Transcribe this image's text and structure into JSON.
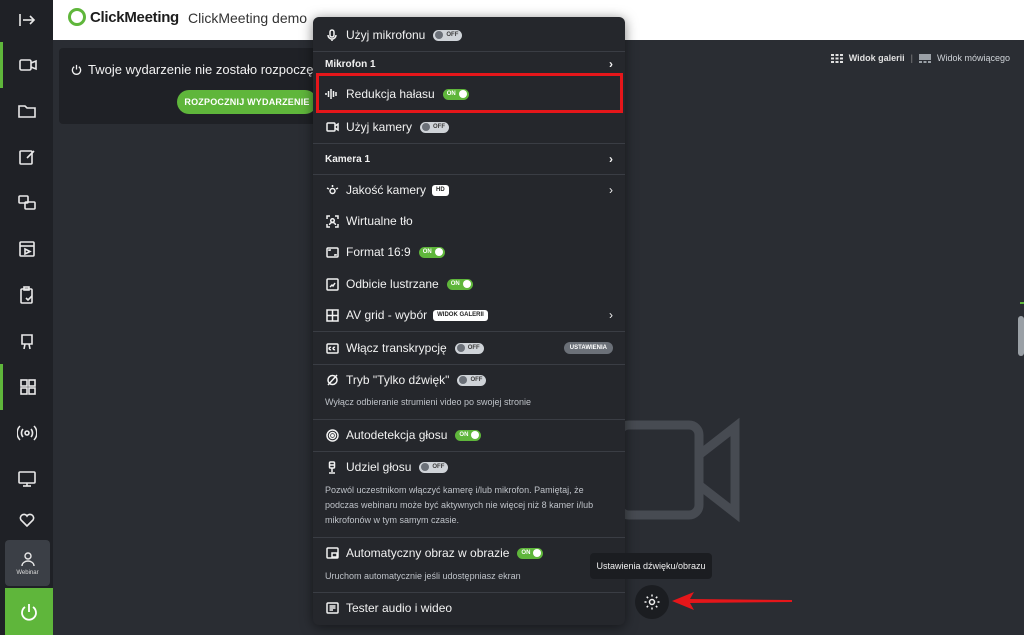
{
  "app": {
    "logo_text": "ClickMeeting",
    "title": "ClickMeeting demo"
  },
  "sidebar": {
    "items": [
      "expand-icon",
      "video-icon",
      "folder-icon",
      "edit-icon",
      "share-screen-icon",
      "presentation-icon",
      "checklist-icon",
      "whiteboard-icon",
      "layout-icon",
      "broadcast-icon",
      "monitor-icon",
      "heart-icon"
    ],
    "webinar_label": "Webinar"
  },
  "event": {
    "status_text": "Twoje wydarzenie nie zostało rozpoczęte",
    "start_button": "ROZPOCZNIJ WYDARZENIE"
  },
  "views": {
    "gallery": "Widok galerii",
    "separator": "|",
    "speaker": "Widok mówiącego"
  },
  "menu": {
    "mic_label": "Użyj mikrofonu",
    "mic_state": "OFF",
    "mic_device": "Mikrofon 1",
    "noise_label": "Redukcja hałasu",
    "noise_state": "ON",
    "camera_label": "Użyj kamery",
    "camera_state": "OFF",
    "camera_device": "Kamera 1",
    "quality_label": "Jakość kamery",
    "quality_badge": "HD",
    "virtual_bg_label": "Wirtualne tło",
    "format_label": "Format 16:9",
    "format_state": "ON",
    "mirror_label": "Odbicie lustrzane",
    "mirror_state": "ON",
    "grid_label": "AV grid - wybór",
    "grid_badge": "WIDOK GALERII",
    "transcription_label": "Włącz transkrypcję",
    "transcription_state": "OFF",
    "transcription_settings": "USTAWIENIA",
    "audio_only_label": "Tryb \"Tylko dźwięk\"",
    "audio_only_state": "OFF",
    "audio_only_desc": "Wyłącz odbieranie strumieni video po swojej stronie",
    "autodetect_label": "Autodetekcja głosu",
    "autodetect_state": "ON",
    "give_voice_label": "Udziel głosu",
    "give_voice_state": "OFF",
    "give_voice_desc": "Pozwól uczestnikom włączyć kamerę i/lub mikrofon. Pamiętaj, że podczas webinaru może być aktywnych nie więcej niż 8 kamer i/lub mikrofonów w tym samym czasie.",
    "pip_label": "Automatyczny obraz w obrazie",
    "pip_state": "ON",
    "pip_desc": "Uruchom automatycznie jeśli udostępniasz ekran",
    "tester_label": "Tester audio i wideo",
    "chevron": "›"
  },
  "tooltip": "Ustawienia dźwięku/obrazu",
  "colors": {
    "accent": "#5fb63b",
    "highlight": "#e5161a",
    "menu_bg": "#25272c",
    "sidebar_bg": "#1f2126"
  }
}
